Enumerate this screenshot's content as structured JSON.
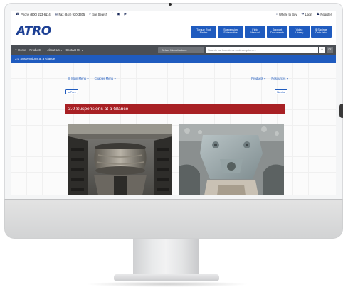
{
  "topbar": {
    "phone": "Phone (800) 223-6114",
    "fax": "Fax (844) 930-3305",
    "site_search": "Site Search",
    "where_to_buy": "Where to Buy",
    "login": "Login",
    "register": "Register"
  },
  "header": {
    "logo": "ATRO",
    "tools": [
      {
        "line1": "Torque Rod",
        "line2": "Finder"
      },
      {
        "line1": "Suspension",
        "line2": "Schematics"
      },
      {
        "line1": "Field",
        "line2": "Manual"
      },
      {
        "line1": "Support",
        "line2": "Documents"
      },
      {
        "line1": "Video",
        "line2": "Library"
      },
      {
        "line1": "$ Savings",
        "line2": "Calculator"
      }
    ]
  },
  "nav": {
    "home": "Home",
    "products": "Products",
    "about": "About Us",
    "contact": "Contact Us",
    "manufacturer_select": "Select Manufacturer",
    "search_placeholder": "Search part numbers or descriptions..."
  },
  "breadcrumb": "3.0 Suspensions at a Glance",
  "content": {
    "main_menu": "Main Menu",
    "chapter_menu": "Chapter Menu",
    "products_menu": "Products",
    "resources_menu": "Resources",
    "prev": "Prev",
    "next": "Next",
    "section_title": "3.0 Suspensions at a Glance"
  }
}
